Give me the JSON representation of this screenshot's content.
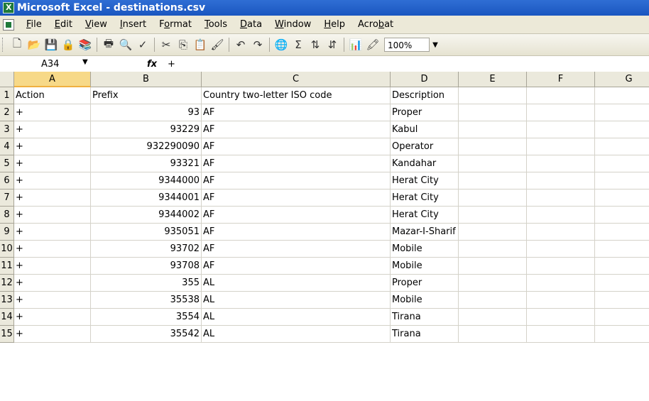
{
  "window": {
    "title": "Microsoft Excel - destinations.csv"
  },
  "menu": [
    {
      "label": "File",
      "u": "F"
    },
    {
      "label": "Edit",
      "u": "E"
    },
    {
      "label": "View",
      "u": "V"
    },
    {
      "label": "Insert",
      "u": "I"
    },
    {
      "label": "Format",
      "u": "o"
    },
    {
      "label": "Tools",
      "u": "T"
    },
    {
      "label": "Data",
      "u": "D"
    },
    {
      "label": "Window",
      "u": "W"
    },
    {
      "label": "Help",
      "u": "H"
    },
    {
      "label": "Acrobat",
      "u": "b"
    }
  ],
  "toolbar": {
    "icons": [
      "new-icon",
      "open-icon",
      "save-icon",
      "permission-icon",
      "research-icon",
      "print-icon",
      "print-preview-icon",
      "spelling-icon",
      "cut-icon",
      "copy-icon",
      "paste-icon",
      "format-painter-icon",
      "undo-icon",
      "redo-icon",
      "hyperlink-icon",
      "autosum-icon",
      "sort-ascending-icon",
      "sort-descending-icon",
      "chart-wizard-icon",
      "drawing-icon"
    ],
    "zoom": "100%"
  },
  "formula": {
    "cell_ref": "A34",
    "fx": "fx",
    "value": "+"
  },
  "columns": [
    "A",
    "B",
    "C",
    "D",
    "E",
    "F",
    "G"
  ],
  "active_column": "A",
  "rows": [
    {
      "n": "1",
      "a": "Action",
      "b": "Prefix",
      "c": "Country two-letter ISO code",
      "d": "Description",
      "b_num": false
    },
    {
      "n": "2",
      "a": "+",
      "b": "93",
      "c": "AF",
      "d": "Proper",
      "b_num": true
    },
    {
      "n": "3",
      "a": "+",
      "b": "93229",
      "c": "AF",
      "d": "Kabul",
      "b_num": true
    },
    {
      "n": "4",
      "a": "+",
      "b": "932290090",
      "c": "AF",
      "d": "Operator",
      "b_num": true
    },
    {
      "n": "5",
      "a": "+",
      "b": "93321",
      "c": "AF",
      "d": "Kandahar",
      "b_num": true
    },
    {
      "n": "6",
      "a": "+",
      "b": "9344000",
      "c": "AF",
      "d": "Herat City",
      "b_num": true
    },
    {
      "n": "7",
      "a": "+",
      "b": "9344001",
      "c": "AF",
      "d": "Herat City",
      "b_num": true
    },
    {
      "n": "8",
      "a": "+",
      "b": "9344002",
      "c": "AF",
      "d": "Herat City",
      "b_num": true
    },
    {
      "n": "9",
      "a": "+",
      "b": "935051",
      "c": "AF",
      "d": "Mazar-I-Sharif",
      "b_num": true
    },
    {
      "n": "10",
      "a": "+",
      "b": "93702",
      "c": "AF",
      "d": "Mobile",
      "b_num": true
    },
    {
      "n": "11",
      "a": "+",
      "b": "93708",
      "c": "AF",
      "d": "Mobile",
      "b_num": true
    },
    {
      "n": "12",
      "a": "+",
      "b": "355",
      "c": "AL",
      "d": "Proper",
      "b_num": true
    },
    {
      "n": "13",
      "a": "+",
      "b": "35538",
      "c": "AL",
      "d": "Mobile",
      "b_num": true
    },
    {
      "n": "14",
      "a": "+",
      "b": "3554",
      "c": "AL",
      "d": "Tirana",
      "b_num": true
    },
    {
      "n": "15",
      "a": "+",
      "b": "35542",
      "c": "AL",
      "d": "Tirana",
      "b_num": true
    }
  ]
}
